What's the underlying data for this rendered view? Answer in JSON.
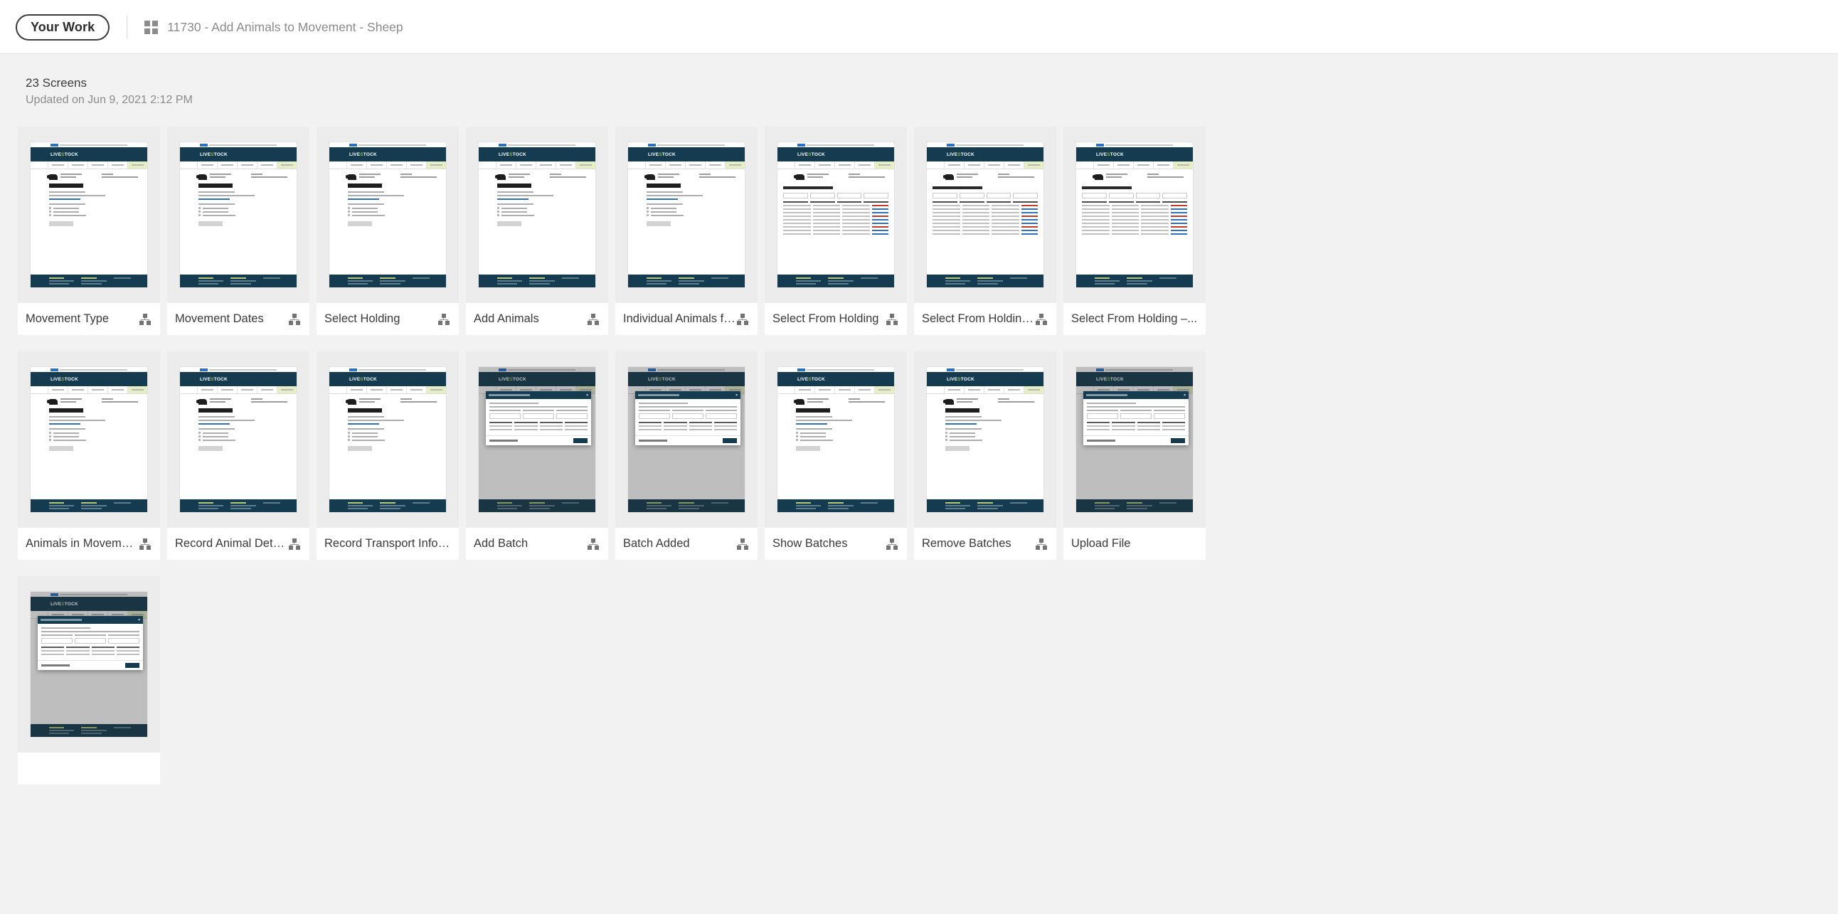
{
  "header": {
    "your_work_label": "Your Work",
    "grid_icon": "grid-icon",
    "breadcrumb": "11730 - Add Animals to Movement - Sheep"
  },
  "section": {
    "count_label": "23 Screens",
    "updated_label": "Updated on Jun 9, 2021 2:12 PM"
  },
  "colors": {
    "page_background": "#f2f2f2",
    "card_background": "#ffffff",
    "thumb_background": "#ececec",
    "app_navy": "#143b4f",
    "app_green": "#8cb63c",
    "text_primary": "#3a3a3a",
    "text_muted": "#8b8b8b",
    "icon_grey": "#747474"
  },
  "screens": [
    {
      "label": "Movement Type",
      "icon": "flowchart-icon",
      "icon_visible": true,
      "variant": "form"
    },
    {
      "label": "Movement Dates",
      "icon": "flowchart-icon",
      "icon_visible": true,
      "variant": "form"
    },
    {
      "label": "Select Holding",
      "icon": "flowchart-icon",
      "icon_visible": true,
      "variant": "form"
    },
    {
      "label": "Add Animals",
      "icon": "flowchart-icon",
      "icon_visible": true,
      "variant": "form"
    },
    {
      "label": "Individual Animals fro...",
      "icon": "flowchart-icon",
      "icon_visible": true,
      "variant": "form"
    },
    {
      "label": "Select From Holding",
      "icon": "flowchart-icon",
      "icon_visible": true,
      "variant": "table"
    },
    {
      "label": "Select From Holding –...",
      "icon": "flowchart-icon",
      "icon_visible": true,
      "variant": "table"
    },
    {
      "label": "Select From Holding –...",
      "icon": "flowchart-icon",
      "icon_visible": false,
      "variant": "table"
    },
    {
      "label": "Animals in Movement ...",
      "icon": "flowchart-icon",
      "icon_visible": true,
      "variant": "form"
    },
    {
      "label": "Record Animal Details",
      "icon": "flowchart-icon",
      "icon_visible": true,
      "variant": "form"
    },
    {
      "label": "Record Transport Information",
      "icon": "flowchart-icon",
      "icon_visible": false,
      "variant": "form"
    },
    {
      "label": "Add Batch",
      "icon": "flowchart-icon",
      "icon_visible": true,
      "variant": "modal"
    },
    {
      "label": "Batch Added",
      "icon": "flowchart-icon",
      "icon_visible": true,
      "variant": "modal"
    },
    {
      "label": "Show Batches",
      "icon": "flowchart-icon",
      "icon_visible": true,
      "variant": "form"
    },
    {
      "label": "Remove Batches",
      "icon": "flowchart-icon",
      "icon_visible": true,
      "variant": "form"
    },
    {
      "label": "Upload File",
      "icon": "flowchart-icon",
      "icon_visible": false,
      "variant": "modal"
    },
    {
      "label": "",
      "icon": "flowchart-icon",
      "icon_visible": false,
      "variant": "modal"
    }
  ],
  "mock_app": {
    "logo_text": "LIVESTOCK",
    "logo_accent": "information"
  }
}
